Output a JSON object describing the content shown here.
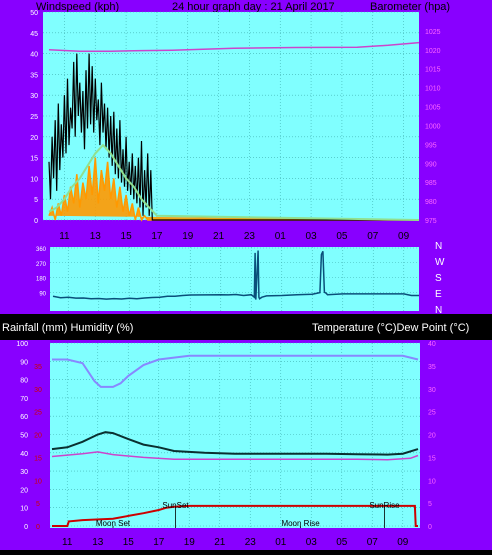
{
  "header": {
    "left_label": "Windspeed (kph)",
    "title": "24 hour graph day : 21 April 2017",
    "right_label": "Barometer (hpa)"
  },
  "section_labels": {
    "rain_humidity": "Rainfall (mm)  Humidity (%)",
    "temp_dew": "Temperature (°C)Dew Point (°C)"
  },
  "colors": {
    "frame": "#8800ff",
    "plot_bg": "#80ffff",
    "grid": "#40b0b0",
    "wind_gust": "#000000",
    "wind_avg": "#90e090",
    "wind_speed": "#ff9900",
    "barometer": "#cc44cc",
    "direction": "#0a4f7a",
    "humidity": "#8888ff",
    "temperature": "#0a3030",
    "dew_point": "#cc44cc",
    "rainfall": "#cc0000",
    "left_axis_text": "#ffffff",
    "right_axis_text": "#ff66ff",
    "rain_axis_text": "#cc0000",
    "x_axis_text": "#000000"
  },
  "x_ticks": [
    "11",
    "13",
    "15",
    "17",
    "19",
    "21",
    "23",
    "01",
    "03",
    "05",
    "07",
    "09"
  ],
  "chart_data": [
    {
      "type": "line",
      "name": "wind-barometer",
      "xlabel": "",
      "ylabel": "Windspeed (kph)",
      "y2label": "Barometer (hpa)",
      "ylim": [
        0,
        50
      ],
      "y2lim": [
        975,
        1030
      ],
      "y_ticks": [
        "0",
        "5",
        "10",
        "15",
        "20",
        "25",
        "30",
        "35",
        "40",
        "45",
        "50"
      ],
      "y2_ticks": [
        "975",
        "980",
        "985",
        "990",
        "995",
        "1000",
        "1005",
        "1010",
        "1015",
        "1020",
        "1025"
      ],
      "grid": true,
      "x_hours": [
        0,
        24
      ],
      "series": [
        {
          "key": "gust",
          "x": [
            0.0,
            0.1,
            0.2,
            0.3,
            0.4,
            0.5,
            0.6,
            0.7,
            0.8,
            0.9,
            1.0,
            1.1,
            1.2,
            1.3,
            1.4,
            1.5,
            1.6,
            1.7,
            1.8,
            1.9,
            2.0,
            2.1,
            2.2,
            2.3,
            2.4,
            2.5,
            2.6,
            2.7,
            2.8,
            2.9,
            3.0,
            3.1,
            3.2,
            3.3,
            3.4,
            3.5,
            3.6,
            3.7,
            3.8,
            3.9,
            4.0,
            4.1,
            4.2,
            4.3,
            4.4,
            4.5,
            4.6,
            4.7,
            4.8,
            4.9,
            5.0,
            5.1,
            5.2,
            5.3,
            5.4,
            5.5,
            5.6,
            5.7,
            5.8,
            5.9,
            6.0,
            6.1,
            6.2,
            6.3,
            6.4,
            6.5,
            6.6,
            6.7,
            7.0,
            8.0,
            24.0
          ],
          "values": [
            14,
            5,
            20,
            10,
            24,
            7,
            28,
            12,
            23,
            15,
            30,
            16,
            34,
            18,
            27,
            22,
            38,
            20,
            40,
            25,
            33,
            21,
            31,
            17,
            36,
            22,
            40,
            23,
            37,
            21,
            34,
            24,
            29,
            18,
            33,
            21,
            28,
            17,
            27,
            15,
            25,
            13,
            26,
            11,
            22,
            10,
            24,
            9,
            17,
            8,
            20,
            7,
            14,
            6,
            16,
            5,
            13,
            4,
            15,
            3,
            19,
            1,
            12,
            3,
            16,
            1,
            12,
            0,
            0,
            0,
            0
          ]
        },
        {
          "key": "average",
          "x": [
            0.0,
            0.5,
            1.0,
            1.5,
            2.0,
            2.5,
            3.0,
            3.5,
            4.0,
            4.5,
            5.0,
            5.5,
            6.0,
            6.5,
            7.0,
            24.0
          ],
          "values": [
            2,
            3,
            5,
            8,
            10,
            13,
            16,
            18,
            16,
            13,
            10,
            8,
            5,
            3,
            1,
            0
          ]
        },
        {
          "key": "speed",
          "x": [
            0.0,
            0.2,
            0.4,
            0.6,
            0.8,
            1.0,
            1.2,
            1.4,
            1.6,
            1.8,
            2.0,
            2.2,
            2.4,
            2.6,
            2.8,
            3.0,
            3.2,
            3.4,
            3.6,
            3.8,
            4.0,
            4.2,
            4.4,
            4.6,
            4.8,
            5.0,
            5.2,
            5.4,
            5.6,
            5.8,
            6.0,
            6.2,
            6.4,
            24.0
          ],
          "values": [
            1,
            3,
            0,
            4,
            1,
            6,
            2,
            8,
            4,
            11,
            3,
            9,
            5,
            13,
            6,
            15,
            4,
            12,
            7,
            14,
            5,
            10,
            3,
            8,
            2,
            6,
            1,
            4,
            0,
            3,
            0,
            1,
            0,
            0
          ]
        },
        {
          "key": "barometer",
          "axis": "right",
          "x": [
            0,
            2,
            4,
            6,
            8,
            12,
            16,
            20,
            22,
            24
          ],
          "values": [
            1020,
            1019.6,
            1019.6,
            1019.8,
            1019.9,
            1020.4,
            1020.6,
            1020.7,
            1021.2,
            1021.9
          ]
        }
      ]
    },
    {
      "type": "line",
      "name": "wind-direction",
      "ylim": [
        0,
        360
      ],
      "y_ticks": [
        "90",
        "180",
        "270",
        "360"
      ],
      "direction_labels": [
        "N",
        "W",
        "S",
        "E",
        "N"
      ],
      "grid": true,
      "x_hours": [
        0,
        24
      ],
      "series": [
        {
          "key": "direction",
          "x": [
            0,
            0.5,
            1,
            1.5,
            2,
            2.5,
            3,
            3.5,
            4,
            4.5,
            5,
            5.5,
            6,
            6.5,
            7,
            7.5,
            8,
            8.5,
            9,
            10,
            11,
            11.5,
            12,
            12.5,
            13,
            13.2,
            13.25,
            13.3,
            13.45,
            13.5,
            13.55,
            13.7,
            14,
            15,
            16,
            17,
            17.5,
            17.6,
            17.7,
            17.8,
            17.9,
            18,
            19,
            20,
            21,
            22,
            23,
            23.5,
            24
          ],
          "values": [
            65,
            57,
            60,
            54,
            55,
            50,
            52,
            48,
            51,
            49,
            53,
            50,
            55,
            58,
            60,
            66,
            65,
            70,
            73,
            74,
            75,
            74,
            76,
            70,
            75,
            60,
            330,
            45,
            345,
            60,
            50,
            60,
            68,
            70,
            75,
            78,
            88,
            320,
            340,
            90,
            85,
            75,
            80,
            80,
            80,
            80,
            80,
            70,
            70
          ]
        }
      ]
    },
    {
      "type": "line",
      "name": "humidity-rain-temperature",
      "ylabel": "Rainfall (mm)  Humidity (%)",
      "y2label": "Temperature (°C)Dew Point (°C)",
      "ylim": [
        0,
        100
      ],
      "y2lim": [
        0,
        40
      ],
      "y_ticks": [
        "0",
        "10",
        "20",
        "30",
        "40",
        "50",
        "60",
        "70",
        "80",
        "90",
        "100"
      ],
      "rain_ticks": [
        "0",
        "5",
        "10",
        "15",
        "20",
        "25",
        "30",
        "35"
      ],
      "y2_ticks": [
        "0",
        "5",
        "10",
        "15",
        "20",
        "25",
        "30",
        "35",
        "40"
      ],
      "grid": true,
      "x_hours": [
        0,
        24
      ],
      "annotations": [
        {
          "label": "SunSet",
          "hour": 8.1
        },
        {
          "label": "SunRise",
          "hour": 21.8
        },
        {
          "label": "Moon Set",
          "hour": 4.0
        },
        {
          "label": "Moon Rise",
          "hour": 16.3
        }
      ],
      "series": [
        {
          "key": "humidity",
          "x": [
            0,
            1,
            2,
            2.8,
            3.2,
            4,
            4.5,
            5,
            6,
            7,
            8,
            9,
            10,
            12,
            16,
            20,
            22,
            23,
            24
          ],
          "values": [
            91,
            91,
            89,
            79,
            76,
            76,
            78,
            82,
            88,
            91,
            92,
            93,
            93,
            93,
            93,
            93,
            93,
            93,
            91
          ]
        },
        {
          "key": "rainfall",
          "axis": "rain",
          "x": [
            0,
            1,
            1.1,
            2,
            4,
            5,
            6,
            7,
            7.5,
            8,
            8.5,
            9,
            10,
            12,
            16,
            20,
            23.8,
            23.85,
            24
          ],
          "values": [
            0,
            0,
            1,
            1.3,
            1.6,
            2.2,
            2.8,
            3.5,
            4.0,
            4.2,
            4.3,
            4.4,
            4.4,
            4.4,
            4.4,
            4.4,
            4.4,
            0,
            0
          ]
        },
        {
          "key": "temperature",
          "axis": "right",
          "x": [
            0,
            1,
            2,
            3,
            3.5,
            4,
            5,
            6,
            7,
            8,
            10,
            12,
            14,
            16,
            18,
            20,
            22,
            23,
            24
          ],
          "values": [
            16.8,
            17.2,
            18.4,
            20,
            20.5,
            20.3,
            19,
            17.8,
            17.2,
            16.4,
            16,
            15.8,
            15.8,
            15.8,
            15.8,
            15.7,
            15.6,
            15.8,
            16.8
          ]
        },
        {
          "key": "dewpoint",
          "axis": "right",
          "x": [
            0,
            2,
            3,
            4,
            6,
            8,
            12,
            16,
            20,
            22,
            23.5,
            24
          ],
          "values": [
            15.2,
            15.8,
            16.2,
            15.6,
            15.0,
            14.6,
            14.6,
            14.6,
            14.6,
            14.5,
            14.8,
            15.4
          ]
        }
      ]
    }
  ]
}
